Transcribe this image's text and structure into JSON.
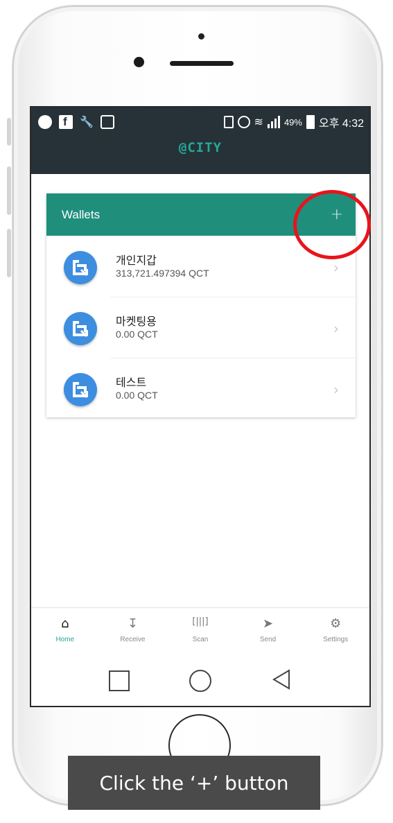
{
  "status": {
    "battery_pct": "49%",
    "time": "오후 4:32"
  },
  "app": {
    "brand": "@CITY"
  },
  "wallets": {
    "title": "Wallets",
    "add_label": "+",
    "items": [
      {
        "name": "개인지갑",
        "balance": "313,721.497394 QCT"
      },
      {
        "name": "마켓팅용",
        "balance": "0.00 QCT"
      },
      {
        "name": "테스트",
        "balance": "0.00 QCT"
      }
    ]
  },
  "tabs": [
    {
      "label": "Home",
      "icon": "home-icon",
      "active": true
    },
    {
      "label": "Receive",
      "icon": "receive-icon",
      "active": false
    },
    {
      "label": "Scan",
      "icon": "barcode-icon",
      "active": false
    },
    {
      "label": "Send",
      "icon": "send-icon",
      "active": false
    },
    {
      "label": "Settings",
      "icon": "settings-icon",
      "active": false
    }
  ],
  "instruction": "Click the ‘+’ button",
  "colors": {
    "header": "#263238",
    "accent": "#1f8f7c",
    "wallet_icon": "#3d8ee0",
    "highlight": "#e8141c"
  }
}
